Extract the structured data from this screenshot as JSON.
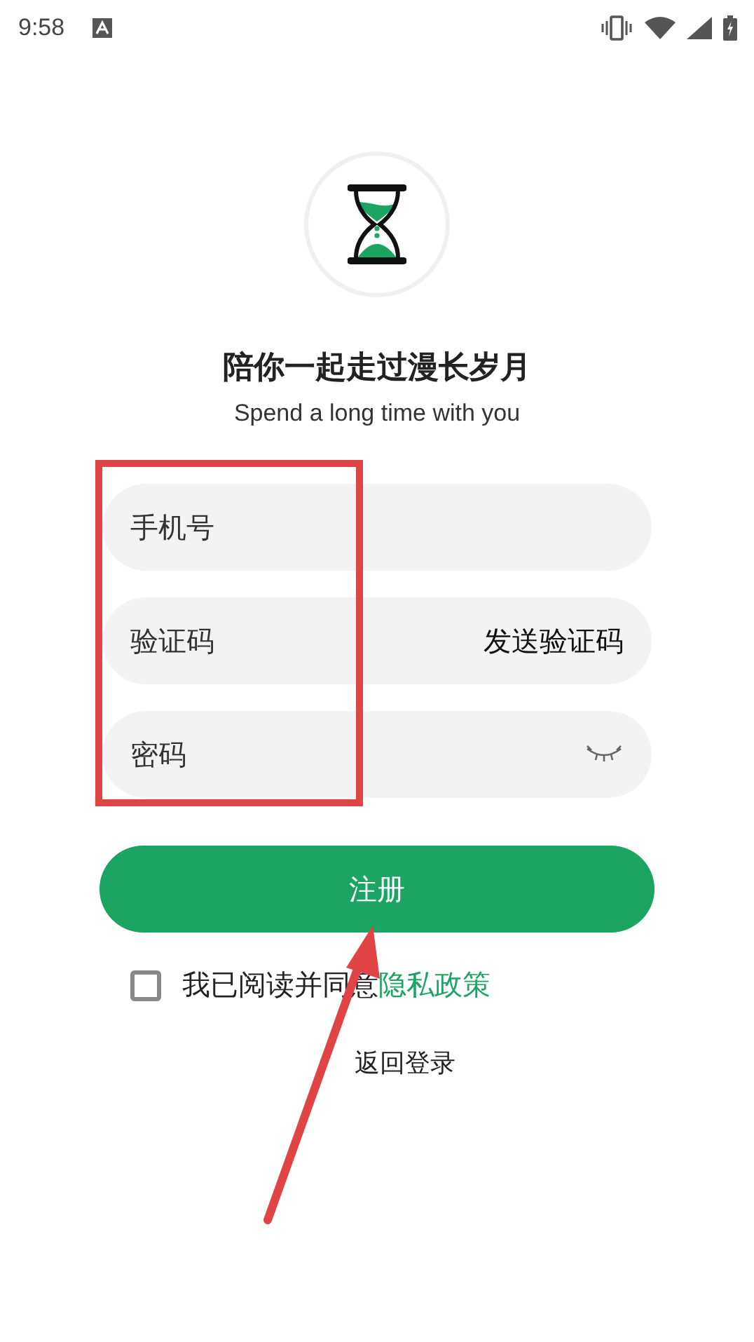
{
  "status_bar": {
    "time": "9:58"
  },
  "title": "陪你一起走过漫长岁月",
  "subtitle": "Spend a long time with you",
  "fields": [
    {
      "kind": "text",
      "placeholder": "手机号"
    },
    {
      "kind": "code",
      "placeholder": "验证码",
      "action": "发送验证码"
    },
    {
      "kind": "password",
      "placeholder": "密码",
      "reveal": false
    }
  ],
  "submit": "注册",
  "agreement": {
    "text": "我已阅读并同意",
    "link": "隐私政策",
    "checked": false
  },
  "back_link": "返回登录",
  "annotation_box": true,
  "annotation_arrow": true
}
